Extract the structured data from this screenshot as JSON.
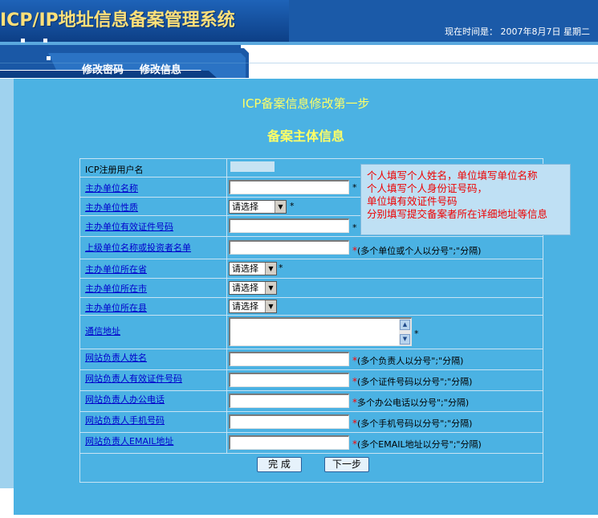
{
  "header": {
    "title": "ICP/IP地址信息备案管理系统",
    "time_label": "现在时间是： 2007年8月7日 星期二",
    "nav": [
      "修改密码",
      "修改信息"
    ]
  },
  "page": {
    "step_title": "ICP备案信息修改第一步",
    "sub_title": "备案主体信息"
  },
  "form": {
    "rows": [
      {
        "label": "ICP注册用户名"
      },
      {
        "label": "主办单位名称",
        "required": "*"
      },
      {
        "label": "主办单位性质",
        "select": "请选择",
        "required": "*"
      },
      {
        "label": "主办单位有效证件号码",
        "required": "*"
      },
      {
        "label": "上级单位名称或投资者名单",
        "hint": "*(多个单位或个人以分号\";\"分隔)"
      },
      {
        "label": "主办单位所在省",
        "select": "请选择",
        "required": "*"
      },
      {
        "label": "主办单位所在市",
        "select": "请选择"
      },
      {
        "label": "主办单位所在县",
        "select": "请选择"
      },
      {
        "label": "通信地址",
        "required": "*"
      },
      {
        "label": "网站负责人姓名",
        "hint": "*(多个负责人以分号\";\"分隔)"
      },
      {
        "label": "网站负责人有效证件号码",
        "hint": "*(多个证件号码以分号\";\"分隔)"
      },
      {
        "label": "网站负责人办公电话",
        "hint": "*多个办公电话以分号\";\"分隔)"
      },
      {
        "label": "网站负责人手机号码",
        "hint": "*(多个手机号码以分号\";\"分隔)"
      },
      {
        "label": "网站负责人EMAIL地址",
        "hint": "*(多个EMAIL地址以分号\";\"分隔)"
      }
    ],
    "buttons": {
      "finish": "完 成",
      "next": "下一步"
    }
  },
  "tooltip": {
    "lines": [
      "个人填写个人姓名，单位填写单位名称",
      "个人填写个人身份证号码，",
      "单位填有效证件号码",
      "分别填写提交备案者所在详细地址等信息"
    ]
  },
  "colors": {
    "panel": "#4bb2e3",
    "title_yellow": "#ffff66",
    "link_blue": "#0000cc",
    "required_red": "#ff0000"
  }
}
